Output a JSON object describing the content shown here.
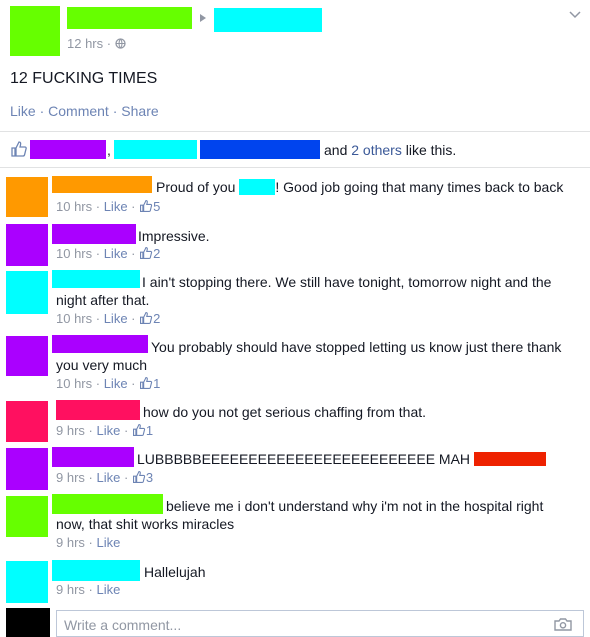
{
  "post": {
    "timestamp": "12 hrs",
    "text": "12 FUCKING TIMES",
    "actions": {
      "like": "Like",
      "comment": "Comment",
      "share": "Share"
    },
    "likes_line": {
      "comma": ",",
      "and": "and",
      "others": "2 others",
      "suffix": "like this."
    }
  },
  "comments": [
    {
      "text_a": "Proud of you",
      "text_b": "! Good job going that many times back to back",
      "time": "10 hrs",
      "like": "Like",
      "likes": "5"
    },
    {
      "text": "Impressive.",
      "time": "10 hrs",
      "like": "Like",
      "likes": "2"
    },
    {
      "text": "I ain't stopping there. We still have tonight, tomorrow night and the",
      "text2": "night after that.",
      "time": "10 hrs",
      "like": "Like",
      "likes": "2"
    },
    {
      "text": "You probably should have stopped letting us know just there thank",
      "text2": "you very much",
      "time": "10 hrs",
      "like": "Like",
      "likes": "1"
    },
    {
      "text": "how do you not get serious chaffing from that.",
      "time": "9 hrs",
      "like": "Like",
      "likes": "1"
    },
    {
      "text": "LUBBBBBEEEEEEEEEEEEEEEEEEEEEEEEE MAH",
      "time": "9 hrs",
      "like": "Like",
      "likes": "3"
    },
    {
      "text": "believe me i don't understand why i'm not in the hospital right",
      "text2": "now, that shit works miracles",
      "time": "9 hrs",
      "like": "Like"
    },
    {
      "text": "Hallelujah",
      "time": "9 hrs",
      "like": "Like"
    }
  ],
  "composer": {
    "placeholder": "Write a comment..."
  },
  "colors": {
    "green": "#66ff00",
    "cyan": "#00ffff",
    "purple": "#aa00ff",
    "blue": "#0044ee",
    "orange": "#ff9900",
    "pink": "#ff1060",
    "red": "#ee2200",
    "black": "#000000",
    "fb_link": "#6d84b4",
    "fb_meta": "#9197a3"
  },
  "icons": {
    "chevron": "chevron-down-icon",
    "globe": "globe-icon",
    "arrow": "triangle-right-icon",
    "thumb": "thumbs-up-icon",
    "camera": "camera-icon"
  }
}
